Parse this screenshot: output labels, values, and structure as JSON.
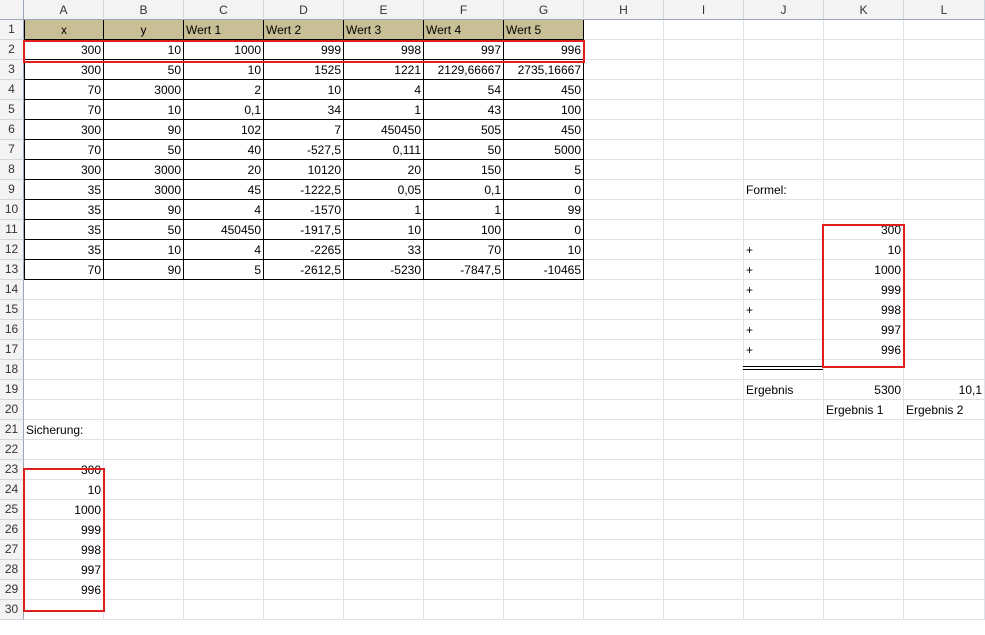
{
  "colors": {
    "header_fill": "#c9bf96",
    "highlight_border": "#e01e1e"
  },
  "columns": [
    "A",
    "B",
    "C",
    "D",
    "E",
    "F",
    "G",
    "H",
    "I",
    "J",
    "K",
    "L"
  ],
  "rows": [
    "1",
    "2",
    "3",
    "4",
    "5",
    "6",
    "7",
    "8",
    "9",
    "10",
    "11",
    "12",
    "13",
    "14",
    "15",
    "16",
    "17",
    "18",
    "19",
    "20",
    "21",
    "22",
    "23",
    "24",
    "25",
    "26",
    "27",
    "28",
    "29",
    "30"
  ],
  "table": {
    "headers": [
      "x",
      "y",
      "Wert 1",
      "Wert 2",
      "Wert 3",
      "Wert 4",
      "Wert 5"
    ],
    "rows": [
      [
        "300",
        "10",
        "1000",
        "999",
        "998",
        "997",
        "996"
      ],
      [
        "300",
        "50",
        "10",
        "1525",
        "1221",
        "2129,66667",
        "2735,16667"
      ],
      [
        "70",
        "3000",
        "2",
        "10",
        "4",
        "54",
        "450"
      ],
      [
        "70",
        "10",
        "0,1",
        "34",
        "1",
        "43",
        "100"
      ],
      [
        "300",
        "90",
        "102",
        "7",
        "450450",
        "505",
        "450"
      ],
      [
        "70",
        "50",
        "40",
        "-527,5",
        "0,111",
        "50",
        "5000"
      ],
      [
        "300",
        "3000",
        "20",
        "10120",
        "20",
        "150",
        "5"
      ],
      [
        "35",
        "3000",
        "45",
        "-1222,5",
        "0,05",
        "0,1",
        "0"
      ],
      [
        "35",
        "90",
        "4",
        "-1570",
        "1",
        "1",
        "99"
      ],
      [
        "35",
        "50",
        "450450",
        "-1917,5",
        "10",
        "100",
        "0"
      ],
      [
        "35",
        "10",
        "4",
        "-2265",
        "33",
        "70",
        "10"
      ],
      [
        "70",
        "90",
        "5",
        "-2612,5",
        "-5230",
        "-7847,5",
        "-10465"
      ]
    ]
  },
  "formula": {
    "label": "Formel:",
    "operators": [
      "",
      "+",
      "+",
      "+",
      "+",
      "+",
      "+"
    ],
    "values": [
      "300",
      "10",
      "1000",
      "999",
      "998",
      "997",
      "996"
    ],
    "result_label": "Ergebnis",
    "result_1": "5300",
    "result_2": "10,1",
    "result_1_caption": "Ergebnis 1",
    "result_2_caption": "Ergebnis 2"
  },
  "backup": {
    "label": "Sicherung:",
    "values": [
      "300",
      "10",
      "1000",
      "999",
      "998",
      "997",
      "996"
    ]
  }
}
